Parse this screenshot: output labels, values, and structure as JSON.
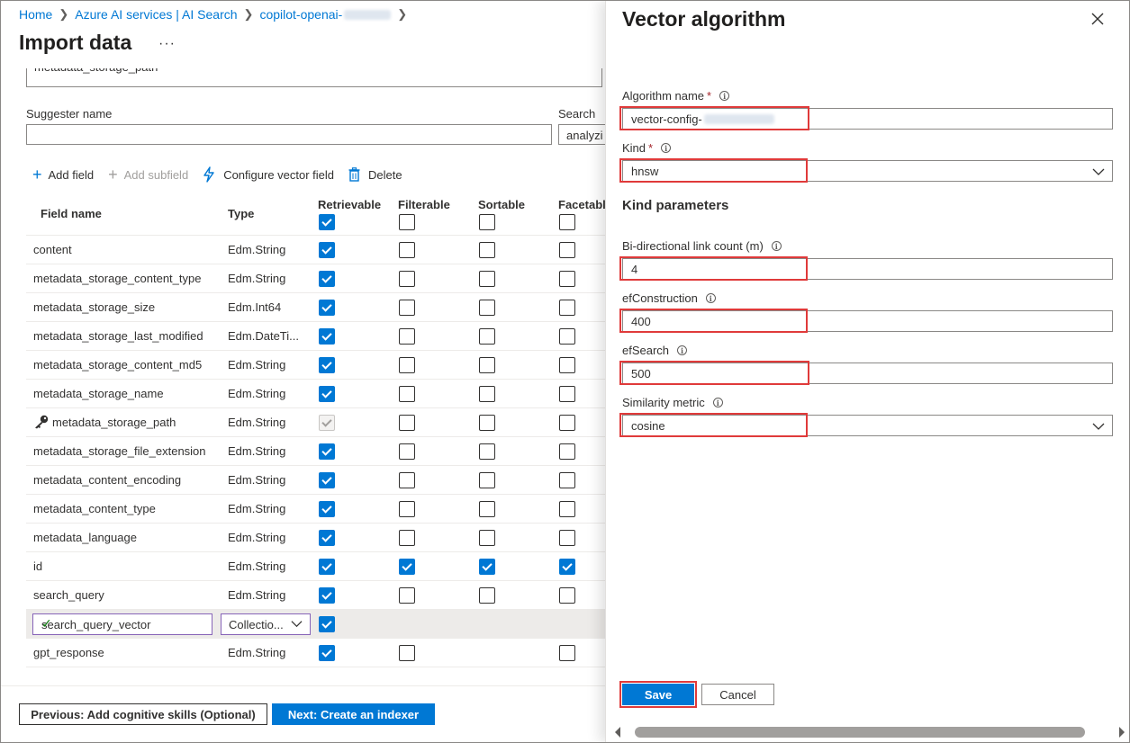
{
  "breadcrumb": [
    {
      "label": "Home"
    },
    {
      "label": "Azure AI services | AI Search"
    },
    {
      "label": "copilot-openai-"
    }
  ],
  "page": {
    "title": "Import data",
    "more_label": "···"
  },
  "index_form": {
    "partial_field_value": "metadata_storage_path",
    "suggester_label": "Suggester name",
    "suggester_value": "",
    "search_mode_label": "Search m",
    "search_mode_value": "analyzi"
  },
  "toolbar": {
    "add_field": "Add field",
    "add_subfield": "Add subfield",
    "configure_vector_field": "Configure vector field",
    "delete": "Delete"
  },
  "grid": {
    "columns": {
      "field_name": "Field name",
      "type": "Type",
      "retrievable": "Retrievable",
      "filterable": "Filterable",
      "sortable": "Sortable",
      "facetable": "Facetable"
    },
    "header_checks": {
      "retrievable": true,
      "filterable": false,
      "sortable": false,
      "facetable": false
    },
    "rows": [
      {
        "name": "content",
        "type": "Edm.String",
        "r": true,
        "f": false,
        "s": false,
        "fa": false
      },
      {
        "name": "metadata_storage_content_type",
        "type": "Edm.String",
        "r": true,
        "f": false,
        "s": false,
        "fa": false
      },
      {
        "name": "metadata_storage_size",
        "type": "Edm.Int64",
        "r": true,
        "f": false,
        "s": false,
        "fa": false
      },
      {
        "name": "metadata_storage_last_modified",
        "type": "Edm.DateTi...",
        "r": true,
        "f": false,
        "s": false,
        "fa": false
      },
      {
        "name": "metadata_storage_content_md5",
        "type": "Edm.String",
        "r": true,
        "f": false,
        "s": false,
        "fa": false
      },
      {
        "name": "metadata_storage_name",
        "type": "Edm.String",
        "r": true,
        "f": false,
        "s": false,
        "fa": false
      },
      {
        "name": "metadata_storage_path",
        "type": "Edm.String",
        "key": true,
        "r": "disabled",
        "f": false,
        "s": false,
        "fa": false
      },
      {
        "name": "metadata_storage_file_extension",
        "type": "Edm.String",
        "r": true,
        "f": false,
        "s": false,
        "fa": false
      },
      {
        "name": "metadata_content_encoding",
        "type": "Edm.String",
        "r": true,
        "f": false,
        "s": false,
        "fa": false
      },
      {
        "name": "metadata_content_type",
        "type": "Edm.String",
        "r": true,
        "f": false,
        "s": false,
        "fa": false
      },
      {
        "name": "metadata_language",
        "type": "Edm.String",
        "r": true,
        "f": false,
        "s": false,
        "fa": false
      },
      {
        "name": "id",
        "type": "Edm.String",
        "r": true,
        "f": true,
        "s": true,
        "fa": true
      },
      {
        "name": "search_query",
        "type": "Edm.String",
        "r": true,
        "f": false,
        "s": false,
        "fa": false
      },
      {
        "name": "search_query_vector",
        "type": "Collectio...",
        "editing": true,
        "r": true,
        "f": null,
        "s": null,
        "fa": null
      },
      {
        "name": "gpt_response",
        "type": "Edm.String",
        "r": true,
        "f": false,
        "s": null,
        "fa": false
      }
    ]
  },
  "footer": {
    "previous_label": "Previous: Add cognitive skills (Optional)",
    "next_label": "Next: Create an indexer"
  },
  "panel": {
    "title": "Vector algorithm",
    "algorithm_name_label": "Algorithm name",
    "algorithm_name_value": "vector-config-",
    "kind_label": "Kind",
    "kind_value": "hnsw",
    "kind_parameters_heading": "Kind parameters",
    "m_label": "Bi-directional link count (m)",
    "m_value": "4",
    "ef_construction_label": "efConstruction",
    "ef_construction_value": "400",
    "ef_search_label": "efSearch",
    "ef_search_value": "500",
    "similarity_label": "Similarity metric",
    "similarity_value": "cosine",
    "required_mark": "*",
    "info_glyph": "i",
    "save_label": "Save",
    "cancel_label": "Cancel"
  },
  "icons": {
    "add": "plus-icon",
    "vector": "lightning-icon",
    "delete": "trash-icon",
    "key": "key-icon",
    "close": "close-icon",
    "chevron": "chevron-down-icon",
    "info": "info-icon"
  },
  "colors": {
    "accent": "#0078d4",
    "highlight": "#e03a3a",
    "required": "#a4262c",
    "edit_border": "#8764b8"
  }
}
